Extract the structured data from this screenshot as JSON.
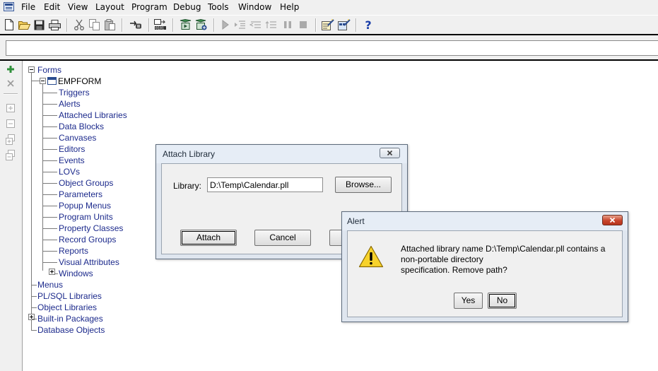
{
  "menubar": {
    "items": [
      "File",
      "Edit",
      "View",
      "Layout",
      "Program",
      "Debug",
      "Tools",
      "Window",
      "Help"
    ]
  },
  "toolbar": {
    "icons": [
      "new-icon",
      "open-icon",
      "save-icon",
      "print-icon",
      "cut-icon",
      "copy-icon",
      "paste-icon",
      "connect-icon",
      "compile-icon",
      "run-form-icon",
      "debug-form-icon",
      "go-icon",
      "step-into-icon",
      "step-over-icon",
      "step-out-icon",
      "pause-icon",
      "stop-icon",
      "wizard-icon",
      "layout-wizard-icon",
      "help-icon"
    ],
    "help_glyph": "?"
  },
  "entry": {
    "value": ""
  },
  "vtools": {
    "icons": [
      "create-icon",
      "delete-icon",
      "expand-icon",
      "collapse-icon",
      "expand-all-icon",
      "collapse-all-icon"
    ]
  },
  "navigator": {
    "forms": "Forms",
    "module": "EMPFORM",
    "children": [
      "Triggers",
      "Alerts",
      "Attached Libraries",
      "Data Blocks",
      "Canvases",
      "Editors",
      "Events",
      "LOVs",
      "Object Groups",
      "Parameters",
      "Popup Menus",
      "Program Units",
      "Property Classes",
      "Record Groups",
      "Reports",
      "Visual Attributes",
      "Windows"
    ],
    "top_level": [
      "Menus",
      "PL/SQL Libraries",
      "Object Libraries",
      "Built-in Packages",
      "Database Objects"
    ]
  },
  "attach_dialog": {
    "title": "Attach Library",
    "library_label": "Library:",
    "library_value": "D:\\Temp\\Calendar.pll",
    "browse_label": "Browse...",
    "attach_label": "Attach",
    "cancel_label": "Cancel"
  },
  "alert_dialog": {
    "title": "Alert",
    "message_lines": [
      "Attached library name D:\\Temp\\Calendar.pll contains a",
      "non-portable directory",
      "specification. Remove path?"
    ],
    "yes_label": "Yes",
    "no_label": "No",
    "icon": "warning-icon"
  },
  "colors": {
    "tree_text": "#1c2a8c",
    "close_red": "#c8452c",
    "warning_yellow": "#f7d22b"
  }
}
